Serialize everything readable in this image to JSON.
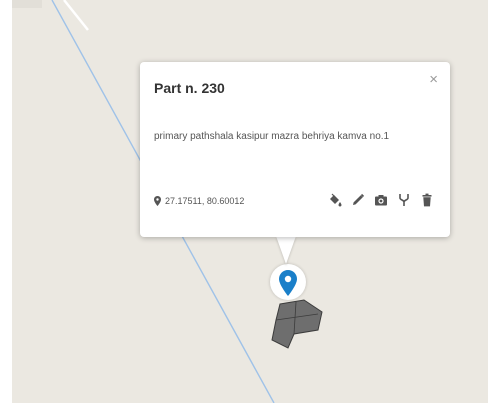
{
  "popup": {
    "title": "Part n. 230",
    "close_symbol": "×",
    "description": "primary pathshala kasipur mazra behriya kamva no.1",
    "coordinates": "27.17511, 80.60012"
  },
  "icons": {
    "location": "location-pin-icon",
    "fill": "fill-bucket-icon",
    "edit": "pencil-icon",
    "camera": "camera-icon",
    "fork": "fork-icon",
    "delete": "trash-icon",
    "marker": "map-marker-icon"
  },
  "colors": {
    "map_background": "#ebe8e1",
    "road": "#9fc2e8",
    "marker": "#1a7fc9",
    "parcel": "#6e6e6e",
    "icon": "#555555"
  }
}
